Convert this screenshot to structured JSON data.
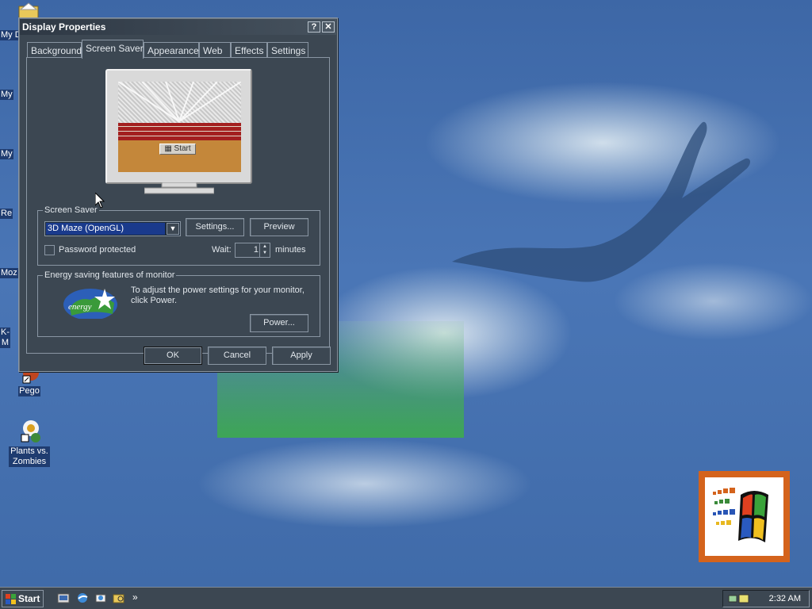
{
  "desktop": {
    "icons": [
      {
        "label": "My D"
      },
      {
        "label": "My"
      },
      {
        "label": "My"
      },
      {
        "label": "Re"
      },
      {
        "label": "Moz"
      },
      {
        "label": "K-M"
      },
      {
        "label": "Pego"
      },
      {
        "label": "Plants vs. Zombies"
      }
    ]
  },
  "window": {
    "title": "Display Properties",
    "help_btn": "?",
    "close_btn": "✕",
    "tabs": [
      "Background",
      "Screen Saver",
      "Appearance",
      "Web",
      "Effects",
      "Settings"
    ],
    "active_tab": "Screen Saver",
    "preview": {
      "start_label": "Start"
    },
    "screen_saver": {
      "group_label": "Screen Saver",
      "selected": "3D Maze (OpenGL)",
      "settings_btn": "Settings...",
      "preview_btn": "Preview",
      "password_label": "Password protected",
      "password_checked": false,
      "wait_label": "Wait:",
      "wait_value": "1",
      "minutes_label": "minutes"
    },
    "energy": {
      "group_label": "Energy saving features of monitor",
      "desc": "To adjust the power settings for your monitor, click Power.",
      "power_btn": "Power..."
    },
    "ok_btn": "OK",
    "cancel_btn": "Cancel",
    "apply_btn": "Apply"
  },
  "taskbar": {
    "start_label": "Start",
    "overflow": "»",
    "clock": "2:32 AM"
  }
}
